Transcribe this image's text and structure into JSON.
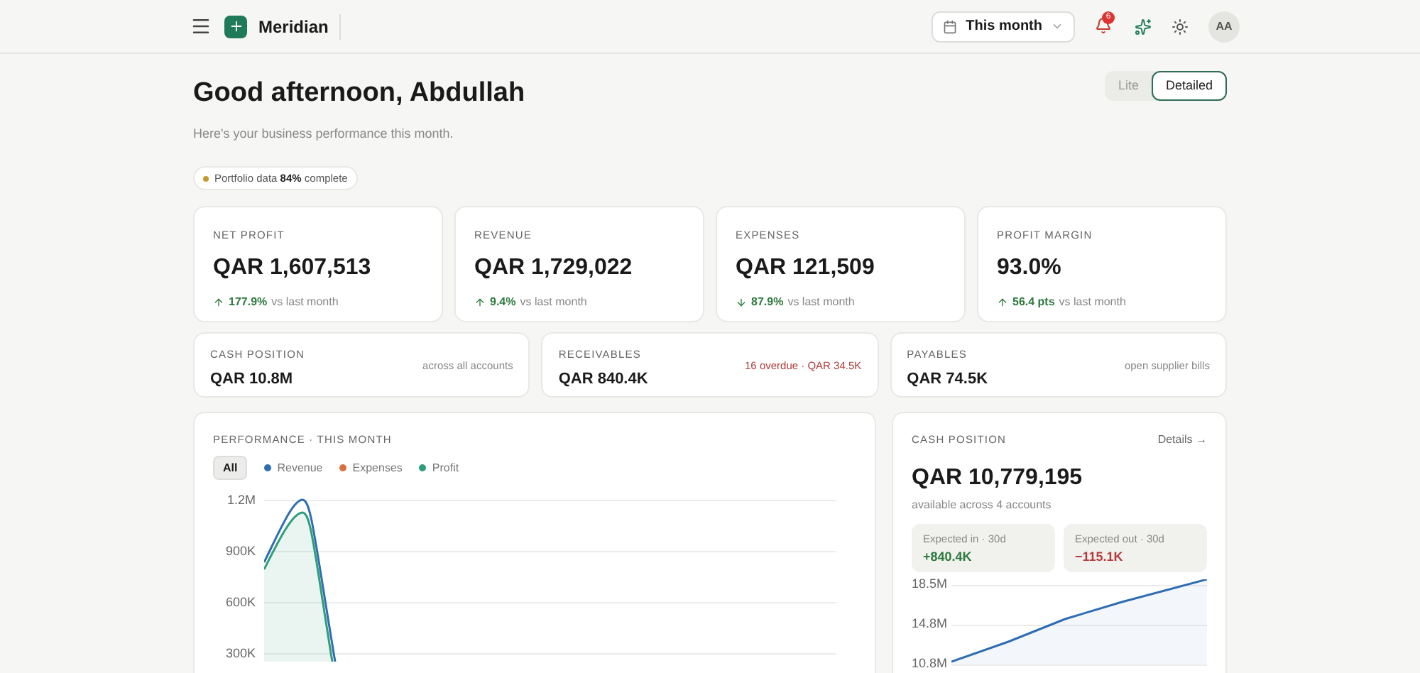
{
  "header": {
    "brand": "Meridian",
    "period": "This month",
    "notification_count": "6",
    "avatar": "AA"
  },
  "view_toggle": [
    {
      "label": "Lite",
      "selected": false
    },
    {
      "label": "Detailed",
      "selected": true
    }
  ],
  "greeting": "Good afternoon, Abdullah",
  "subtitle": "Here's your business performance this month.",
  "completeness": {
    "label": "Portfolio data",
    "value": "84%",
    "suffix": "complete"
  },
  "kpis": [
    {
      "label": "NET PROFIT",
      "value": "QAR 1,607,513",
      "rising": true,
      "change": "177.9%",
      "note": "vs last month"
    },
    {
      "label": "REVENUE",
      "value": "QAR 1,729,022",
      "rising": true,
      "change": "9.4%",
      "note": "vs last month"
    },
    {
      "label": "EXPENSES",
      "value": "QAR 121,509",
      "rising": false,
      "change": "87.9%",
      "note": "vs last month"
    },
    {
      "label": "PROFIT MARGIN",
      "value": "93.0%",
      "rising": true,
      "change": "56.4 pts",
      "note": "vs last month"
    }
  ],
  "summaries": [
    {
      "label": "CASH POSITION",
      "value": "QAR 10.8M",
      "note": "across all accounts",
      "alert": false
    },
    {
      "label": "RECEIVABLES",
      "value": "QAR 840.4K",
      "note": "16 overdue · QAR 34.5K",
      "alert": true
    },
    {
      "label": "PAYABLES",
      "value": "QAR 74.5K",
      "note": "open supplier bills",
      "alert": false
    }
  ],
  "performance": {
    "title": "PERFORMANCE · THIS MONTH",
    "filters": [
      {
        "label": "All",
        "kind": "all",
        "selected": true
      },
      {
        "label": "Revenue",
        "kind": "series",
        "color": "#2f6db3",
        "selected": false
      },
      {
        "label": "Expenses",
        "kind": "series",
        "color": "#d9703f",
        "selected": false
      },
      {
        "label": "Profit",
        "kind": "series",
        "color": "#2e9e78",
        "selected": false
      }
    ],
    "y_axis_labels": [
      "1.2M",
      "900K",
      "600K",
      "300K"
    ]
  },
  "cash": {
    "title": "CASH POSITION",
    "link": "Details →",
    "value": "QAR 10,779,195",
    "note": "available across 4 accounts",
    "expected": [
      {
        "label": "Expected in · 30d",
        "value": "+840.4K",
        "positive": true
      },
      {
        "label": "Expected out · 30d",
        "value": "−115.1K",
        "positive": false
      }
    ],
    "y_axis_labels": [
      "18.5M",
      "14.8M",
      "10.8M"
    ]
  }
}
